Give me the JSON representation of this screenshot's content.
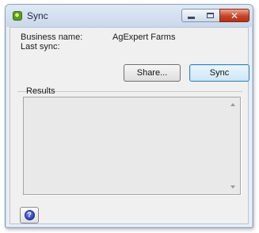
{
  "window": {
    "title": "Sync",
    "app_icon": "app-logo-icon",
    "controls": {
      "minimize_icon": "minimize-icon",
      "maximize_icon": "maximize-icon",
      "close_icon": "close-icon",
      "close_glyph": "✕"
    }
  },
  "info": {
    "business_label": "Business name:",
    "business_value": "AgExpert Farms",
    "last_sync_label": "Last sync:"
  },
  "actions": {
    "share_label": "Share...",
    "sync_label": "Sync"
  },
  "results": {
    "label": "Results"
  },
  "help": {
    "icon": "help-icon",
    "glyph": "?"
  },
  "colors": {
    "close_button": "#c4452a",
    "default_button_border": "#3c7fb1",
    "dialog_background": "#f0f0f0"
  }
}
